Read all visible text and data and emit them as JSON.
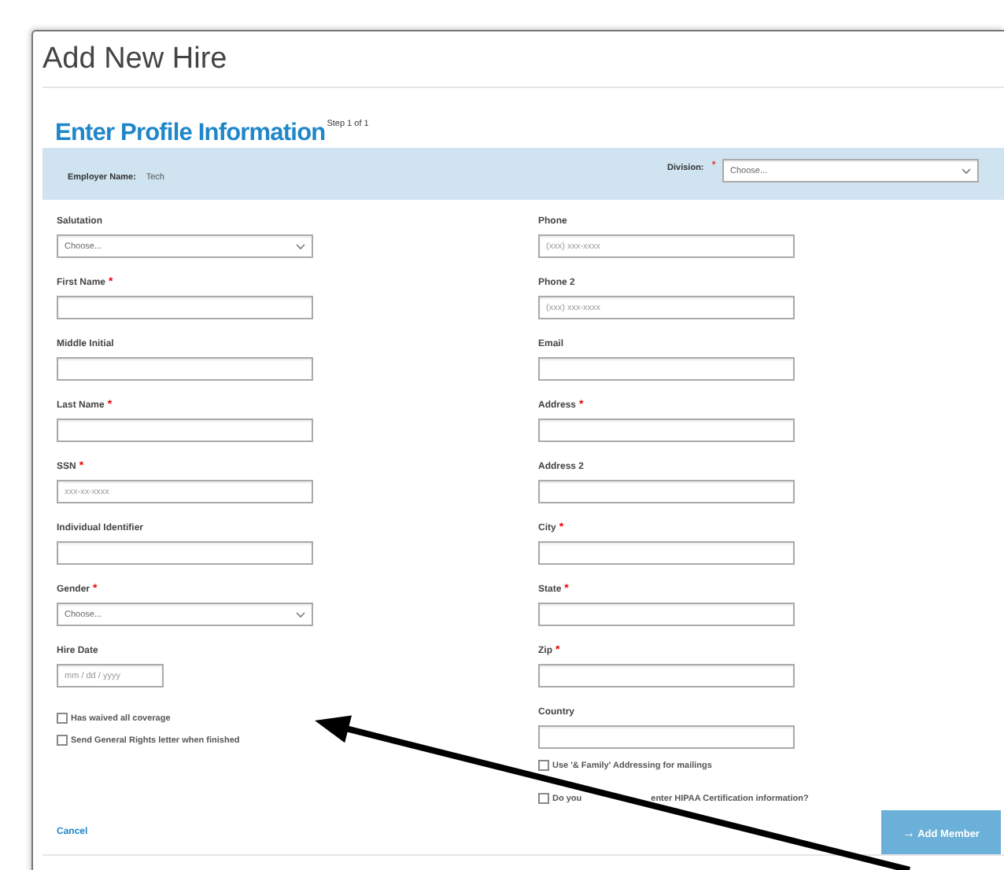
{
  "dialog": {
    "title": "Add New Hire"
  },
  "section": {
    "heading": "Enter Profile Information",
    "step": "Step 1 of 1"
  },
  "band": {
    "employer_label": "Employer Name:",
    "employer_value": "Tech",
    "division_label": "Division:",
    "division_required_mark": "*",
    "division_placeholder": "Choose..."
  },
  "left_fields": [
    {
      "label": "Salutation",
      "kind": "select",
      "placeholder": "Choose..."
    },
    {
      "label": "First Name",
      "kind": "text",
      "required_mark": "*"
    },
    {
      "label": "Middle Initial",
      "kind": "text"
    },
    {
      "label": "Last Name",
      "kind": "text",
      "required_mark": "*"
    },
    {
      "label": "SSN",
      "kind": "text",
      "required_mark": "*",
      "placeholder": "xxx-xx-xxxx"
    },
    {
      "label": "Individual Identifier",
      "kind": "text"
    },
    {
      "label": "Gender",
      "kind": "select",
      "required_mark": "*",
      "placeholder": "Choose..."
    },
    {
      "label": "Hire Date",
      "kind": "date",
      "placeholder": "mm / dd / yyyy"
    }
  ],
  "right_fields": [
    {
      "label": "Phone",
      "kind": "text",
      "placeholder": "(xxx) xxx-xxxx"
    },
    {
      "label": "Phone 2",
      "kind": "text",
      "placeholder": "(xxx) xxx-xxxx"
    },
    {
      "label": "Email",
      "kind": "text"
    },
    {
      "label": "Address",
      "kind": "text",
      "required_mark": "*"
    },
    {
      "label": "Address 2",
      "kind": "text"
    },
    {
      "label": "City",
      "kind": "text",
      "required_mark": "*"
    },
    {
      "label": "State",
      "kind": "text",
      "required_mark": "*"
    },
    {
      "label": "Zip",
      "kind": "text",
      "required_mark": "*"
    },
    {
      "label": "Country",
      "kind": "text"
    }
  ],
  "left_checkboxes": [
    {
      "label": "Has waived all coverage",
      "checked": false
    },
    {
      "label": "Send General Rights letter when finished",
      "checked": false
    }
  ],
  "right_checkboxes": [
    {
      "label_parts": [
        "Use '& Family' Addressing for mailings"
      ],
      "checked": false
    },
    {
      "label_parts": [
        "Do you",
        "enter HIPAA Certification information?"
      ],
      "checked": false
    }
  ],
  "footer": {
    "cancel": "Cancel",
    "add_button": {
      "icon": "→",
      "label": "Add Member"
    }
  }
}
